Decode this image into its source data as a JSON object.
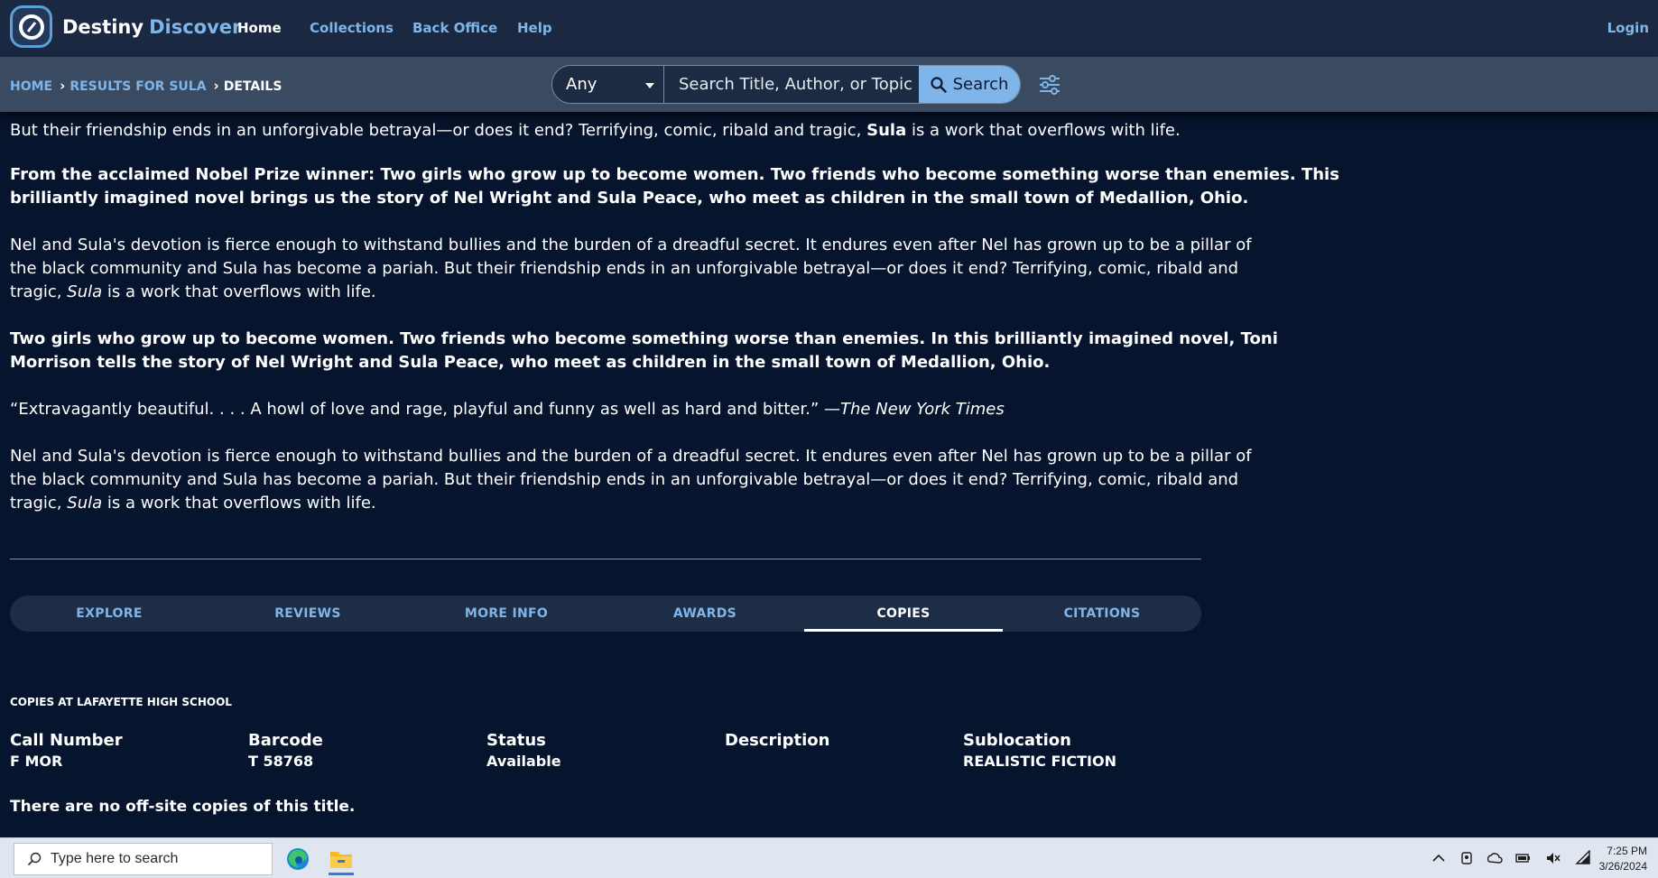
{
  "nav": {
    "brand_1": "Destiny",
    "brand_2": "Discover",
    "links": [
      "Home",
      "Collections",
      "Back Office",
      "Help"
    ],
    "login": "Login"
  },
  "breadcrumb": {
    "home": "HOME",
    "results": "RESULTS FOR SULA",
    "current": "DETAILS"
  },
  "search": {
    "scope": "Any",
    "placeholder": "Search Title, Author, or Topic",
    "button": "Search"
  },
  "description": {
    "partial_line": "But their friendship ends in an unforgivable betrayal—or does it end? Terrifying, comic, ribald and tragic, ",
    "partial_em": "Sula",
    "partial_end": " is a work that overflows with life.",
    "p1_l1": "From the acclaimed Nobel Prize winner: Two girls who grow up to become women. Two friends who become something worse than enemies. This",
    "p1_l2": "brilliantly imagined novel brings us the story of Nel Wright and Sula Peace, who meet as children in the small town of Medallion, Ohio.",
    "p2_l1": "Nel and Sula's devotion is fierce enough to withstand bullies and the burden of a dreadful secret. It endures even after Nel has grown up to be a pillar of",
    "p2_l2": "the black community and Sula has become a pariah. But their friendship ends in an unforgivable betrayal—or does it end? Terrifying, comic, ribald and",
    "p2_l3_a": "tragic, ",
    "p2_l3_em": "Sula",
    "p2_l3_b": " is a work that overflows with life.",
    "p3_l1": "Two girls who grow up to become women. Two friends who become something worse than enemies. In this brilliantly imagined novel, Toni",
    "p3_l2": "Morrison tells the story of Nel Wright and Sula Peace, who meet as children in the small town of Medallion, Ohio.",
    "quote": "“Extravagantly beautiful. . . .  A howl of love and rage, playful and funny as well as hard and bitter.” —",
    "quote_source": "The New York Times",
    "p4_l1": "Nel and Sula's devotion is fierce enough to withstand bullies and the burden of a dreadful secret. It endures even after Nel has grown up to be a pillar of",
    "p4_l2": "the black community and Sula has become a pariah. But their friendship ends in an unforgivable betrayal—or does it end? Terrifying, comic, ribald and",
    "p4_l3_a": "tragic, ",
    "p4_l3_em": "Sula",
    "p4_l3_b": " is a work that overflows with life."
  },
  "tabs": [
    "EXPLORE",
    "REVIEWS",
    "MORE INFO",
    "AWARDS",
    "COPIES",
    "CITATIONS"
  ],
  "active_tab": "COPIES",
  "copies": {
    "heading": "COPIES AT LAFAYETTE HIGH SCHOOL",
    "columns": [
      "Call Number",
      "Barcode",
      "Status",
      "Description",
      "Sublocation"
    ],
    "row": [
      "F MOR",
      "T 58768",
      "Available",
      "",
      "REALISTIC FICTION"
    ],
    "offsite": "There are no off-site copies of this title."
  },
  "taskbar": {
    "search_placeholder": "Type here to search",
    "time": "7:25 PM",
    "date": "3/26/2024"
  },
  "colors": {
    "background": "#06142d",
    "nav": "#1a2841",
    "accent": "#7fb5e8"
  }
}
